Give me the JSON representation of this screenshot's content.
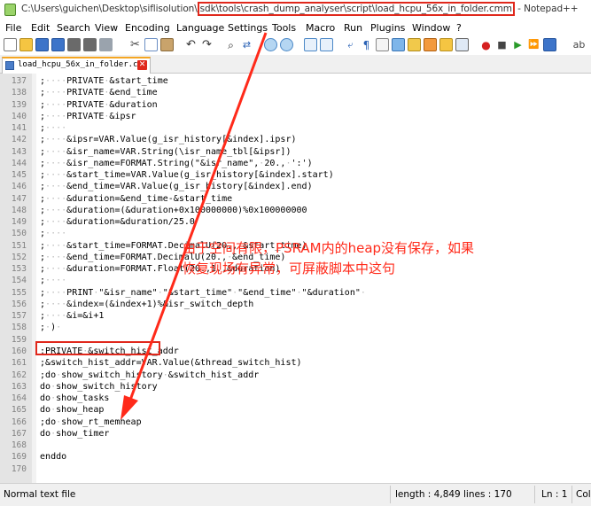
{
  "window": {
    "title_prefix": "C:\\Users\\guichen\\Desktop\\siflisolution\\",
    "title_highlight": "sdk\\tools\\crash_dump_analyser\\script\\load_hcpu_56x_in_folder.cmm",
    "title_suffix": " - Notepad++"
  },
  "menu": [
    "File",
    "Edit",
    "Search",
    "View",
    "Encoding",
    "Language",
    "Settings",
    "Tools",
    "Macro",
    "Run",
    "Plugins",
    "Window",
    "?"
  ],
  "toolbar": {
    "icons": [
      "new-file-icon",
      "open-file-icon",
      "save-icon",
      "save-all-icon",
      "close-icon",
      "close-all-icon",
      "print-icon",
      "cut-icon",
      "copy-icon",
      "paste-icon",
      "undo-icon",
      "redo-icon",
      "find-icon",
      "replace-icon",
      "zoom-in-icon",
      "zoom-out-icon",
      "sync-v-icon",
      "sync-h-icon",
      "word-wrap-icon",
      "show-all-chars-icon",
      "indent-guide-icon",
      "udl-icon",
      "doc-map-icon",
      "function-list-icon",
      "folder-workspace-icon",
      "monitor-icon",
      "record-macro-icon",
      "stop-macro-icon",
      "play-macro-icon",
      "run-macro-multiple-icon",
      "save-macro-icon"
    ]
  },
  "tab": {
    "label": "load_hcpu_56x_in_folder.cmm",
    "close": "✕"
  },
  "editor": {
    "lines": [
      {
        "n": "137",
        "t": ";····PRIVATE·&start_time"
      },
      {
        "n": "138",
        "t": ";····PRIVATE·&end_time"
      },
      {
        "n": "139",
        "t": ";····PRIVATE·&duration"
      },
      {
        "n": "140",
        "t": ";····PRIVATE·&ipsr"
      },
      {
        "n": "141",
        "t": ";····"
      },
      {
        "n": "142",
        "t": ";····&ipsr=VAR.Value(g_isr_history[&index].ipsr)"
      },
      {
        "n": "143",
        "t": ";····&isr_name=VAR.String(\\isr_name_tbl[&ipsr])"
      },
      {
        "n": "144",
        "t": ";····&isr_name=FORMAT.String(\"&isr_name\",·20.,·':')"
      },
      {
        "n": "145",
        "t": ";····&start_time=VAR.Value(g_isr_history[&index].start)"
      },
      {
        "n": "146",
        "t": ";····&end_time=VAR.Value(g_isr_history[&index].end)"
      },
      {
        "n": "147",
        "t": ";····&duration=&end_time-&start_time"
      },
      {
        "n": "148",
        "t": ";····&duration=(&duration+0x100000000)%0x100000000"
      },
      {
        "n": "149",
        "t": ";····&duration=&duration/25.0"
      },
      {
        "n": "150",
        "t": ";····"
      },
      {
        "n": "151",
        "t": ";····&start_time=FORMAT.DecimalU(20.,·&start_time)"
      },
      {
        "n": "152",
        "t": ";····&end_time=FORMAT.DecimalU(20.,·&end_time)"
      },
      {
        "n": "153",
        "t": ";····&duration=FORMAT.Float(20.,1.,&duration)"
      },
      {
        "n": "154",
        "t": ";····"
      },
      {
        "n": "155",
        "t": ";····PRINT·\"&isr_name\"·\"&start_time\"·\"&end_time\"·\"&duration\"·"
      },
      {
        "n": "156",
        "t": ";····&index=(&index+1)%&isr_switch_depth"
      },
      {
        "n": "157",
        "t": ";····&i=&i+1"
      },
      {
        "n": "158",
        "t": ";·)·"
      },
      {
        "n": "159",
        "t": ""
      },
      {
        "n": "160",
        "t": ";PRIVATE·&switch_hist_addr"
      },
      {
        "n": "161",
        "t": ";&switch_hist_addr=VAR.Value(&thread_switch_hist)"
      },
      {
        "n": "162",
        "t": ";do·show_switch_history·&switch_hist_addr"
      },
      {
        "n": "163",
        "t": "do·show_switch_history"
      },
      {
        "n": "164",
        "t": "do·show_tasks"
      },
      {
        "n": "165",
        "t": "do·show_heap"
      },
      {
        "n": "166",
        "t": ";do·show_rt_memheap"
      },
      {
        "n": "167",
        "t": "do·show_timer"
      },
      {
        "n": "168",
        "t": ""
      },
      {
        "n": "169",
        "t": "enddo"
      },
      {
        "n": "170",
        "t": ""
      }
    ]
  },
  "annotation": {
    "line1": "由于空间有限，PSRAM内的heap没有保存，如果",
    "line2": "恢复现场有异常，可屏蔽脚本中这句",
    "color": "#ff2a1a"
  },
  "status": {
    "filetype": "Normal text file",
    "length": "length : 4,849",
    "lines": "lines : 170",
    "ln": "Ln : 1",
    "col": "Col"
  }
}
